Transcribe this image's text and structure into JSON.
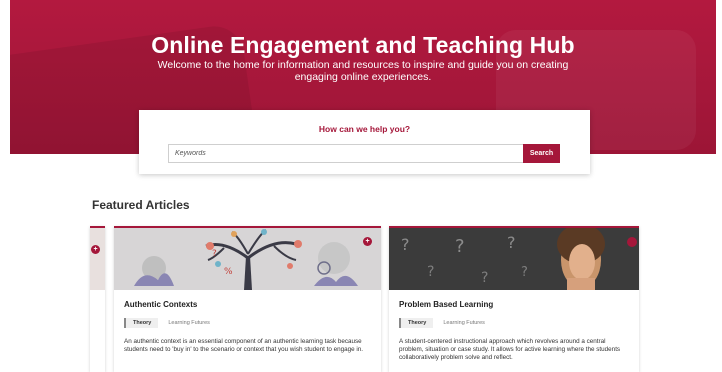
{
  "hero": {
    "title": "Online Engagement and Teaching Hub",
    "subtitle": "Welcome to the home for information and resources to inspire and guide you on creating engaging online experiences."
  },
  "search": {
    "heading": "How can we help you?",
    "placeholder": "Keywords",
    "button_label": "Search"
  },
  "featured": {
    "heading": "Featured Articles",
    "cards": [
      {
        "title": "Authentic Contexts",
        "tag_primary": "Theory",
        "tag_secondary": "Learning Futures",
        "description": "An authentic context is an essential component of an authentic learning task because students need to 'buy in' to the scenario or context that you wish student to engage in.",
        "image": "tree-illustration"
      },
      {
        "title": "Problem Based Learning",
        "tag_primary": "Theory",
        "tag_secondary": "Learning Futures",
        "description": "A student-centered instructional approach which revolves around a central problem, situation or case study. It allows for active learning where the students collaboratively problem solve and reflect.",
        "image": "question-marks-photo"
      }
    ]
  },
  "colors": {
    "brand": "#a5173a",
    "hero_bg": "#b3193f"
  },
  "icons": {
    "card_badge": "plus-circle-icon"
  }
}
